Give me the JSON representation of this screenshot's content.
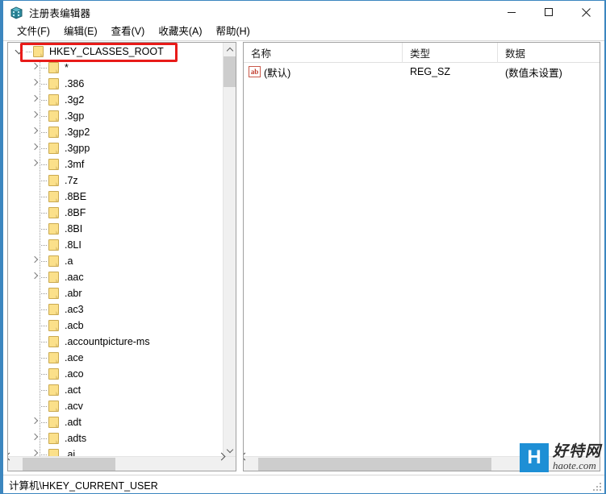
{
  "window": {
    "title": "注册表编辑器",
    "icon": "registry-editor-icon",
    "accent_color": "#3c86bf",
    "controls": [
      {
        "name": "minimize",
        "glyph": "minimize-icon"
      },
      {
        "name": "maximize",
        "glyph": "maximize-icon"
      },
      {
        "name": "close",
        "glyph": "close-icon"
      }
    ]
  },
  "menubar": {
    "items": [
      {
        "label": "文件(F)"
      },
      {
        "label": "编辑(E)"
      },
      {
        "label": "查看(V)"
      },
      {
        "label": "收藏夹(A)"
      },
      {
        "label": "帮助(H)"
      }
    ]
  },
  "tree": {
    "root": {
      "label": "HKEY_CLASSES_ROOT",
      "expanded": true,
      "highlighted": true
    },
    "highlight_color": "#e81b19",
    "children": [
      {
        "label": "*",
        "expandable": true
      },
      {
        "label": ".386",
        "expandable": true
      },
      {
        "label": ".3g2",
        "expandable": true
      },
      {
        "label": ".3gp",
        "expandable": true
      },
      {
        "label": ".3gp2",
        "expandable": true
      },
      {
        "label": ".3gpp",
        "expandable": true
      },
      {
        "label": ".3mf",
        "expandable": true
      },
      {
        "label": ".7z",
        "expandable": false
      },
      {
        "label": ".8BE",
        "expandable": false
      },
      {
        "label": ".8BF",
        "expandable": false
      },
      {
        "label": ".8BI",
        "expandable": false
      },
      {
        "label": ".8LI",
        "expandable": false
      },
      {
        "label": ".a",
        "expandable": true
      },
      {
        "label": ".aac",
        "expandable": true
      },
      {
        "label": ".abr",
        "expandable": false
      },
      {
        "label": ".ac3",
        "expandable": false
      },
      {
        "label": ".acb",
        "expandable": false
      },
      {
        "label": ".accountpicture-ms",
        "expandable": false
      },
      {
        "label": ".ace",
        "expandable": false
      },
      {
        "label": ".aco",
        "expandable": false
      },
      {
        "label": ".act",
        "expandable": false
      },
      {
        "label": ".acv",
        "expandable": false
      },
      {
        "label": ".adt",
        "expandable": true
      },
      {
        "label": ".adts",
        "expandable": true
      },
      {
        "label": ".ai",
        "expandable": true
      }
    ]
  },
  "list": {
    "columns": [
      {
        "label": "名称"
      },
      {
        "label": "类型"
      },
      {
        "label": "数据"
      }
    ],
    "rows": [
      {
        "icon": "string-value-icon",
        "name": "(默认)",
        "type": "REG_SZ",
        "data": "(数值未设置)"
      }
    ]
  },
  "statusbar": {
    "path": "计算机\\HKEY_CURRENT_USER"
  },
  "watermark": {
    "logo_letter": "H",
    "logo_color": "#1e8fd5",
    "name_cn": "好特网",
    "name_en": "haote.com"
  }
}
